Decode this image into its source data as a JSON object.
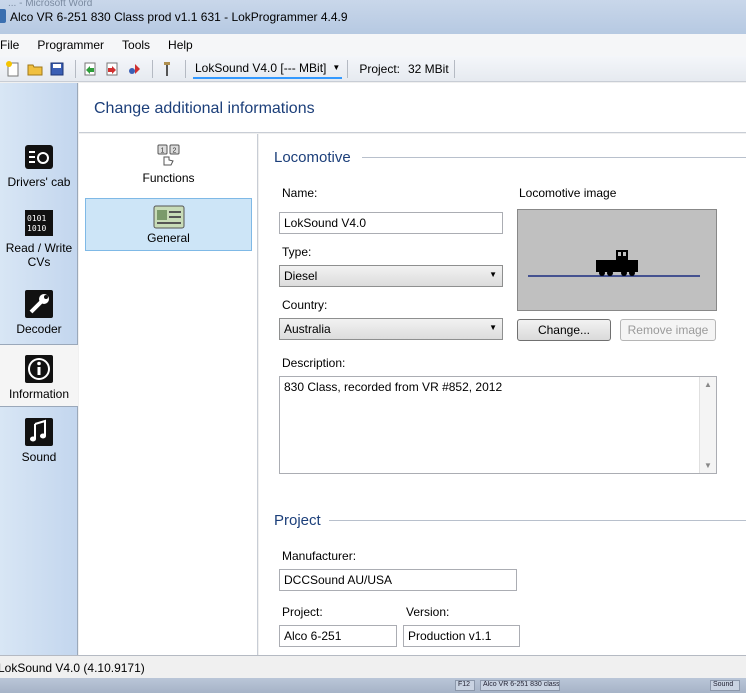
{
  "window": {
    "title": "Alco VR 6-251 830 Class prod v1.1 631 - LokProgrammer 4.4.9",
    "behind_title": "... - Microsoft Word"
  },
  "menu": [
    "File",
    "Programmer",
    "Tools",
    "Help"
  ],
  "toolbar": {
    "icons": [
      "new-icon",
      "open-icon",
      "save-icon",
      "import-icon",
      "export-icon",
      "sound-export-icon",
      "key-icon"
    ],
    "decoder_combo": "LokSound V4.0 [--- MBit]",
    "project_label": "Project:",
    "project_value": "32 MBit"
  },
  "leftnav": {
    "items": [
      {
        "label": "Drivers' cab",
        "icon": "drivers-cab-icon"
      },
      {
        "label": "Read / Write CVs",
        "label1": "Read / Write",
        "label2": "CVs",
        "icon": "read-write-cvs-icon"
      },
      {
        "label": "Decoder",
        "icon": "decoder-icon"
      },
      {
        "label": "Information",
        "icon": "information-icon"
      },
      {
        "label": "Sound",
        "icon": "sound-icon"
      }
    ],
    "active": "Information"
  },
  "header": {
    "title": "Change additional informations"
  },
  "subnav": {
    "items": [
      {
        "label": "Functions",
        "icon": "functions-icon"
      },
      {
        "label": "General",
        "icon": "general-icon"
      }
    ],
    "selected": "General"
  },
  "locomotive": {
    "section_title": "Locomotive",
    "name_label": "Name:",
    "name_value": "LokSound V4.0",
    "type_label": "Type:",
    "type_value": "Diesel",
    "country_label": "Country:",
    "country_value": "Australia",
    "image_label": "Locomotive image",
    "change_button": "Change...",
    "remove_button": "Remove image",
    "description_label": "Description:",
    "description_value": "830 Class, recorded from VR #852, 2012"
  },
  "project": {
    "section_title": "Project",
    "manufacturer_label": "Manufacturer:",
    "manufacturer_value": "DCCSound AU/USA",
    "project_label": "Project:",
    "project_value": "Alco  6-251",
    "version_label": "Version:",
    "version_value": "Production v1.1"
  },
  "statusbar": {
    "text": "LokSound V4.0 (4.10.9171)"
  },
  "taskbar": {
    "items": [
      "F12",
      "Alco VR 6-251 830 class",
      "Sound"
    ]
  },
  "colors": {
    "accent_text": "#1c3f7a",
    "selection_bg": "#cde5f7",
    "loco_image_bg": "#c0c0c0"
  }
}
